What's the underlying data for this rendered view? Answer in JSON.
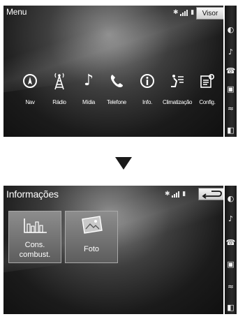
{
  "menu_screen": {
    "title": "Menu",
    "visor_button": "Visor",
    "items": [
      {
        "label": "Nav",
        "icon": "compass-icon"
      },
      {
        "label": "Rádio",
        "icon": "radio-tower-icon"
      },
      {
        "label": "Mídia",
        "icon": "music-note-icon"
      },
      {
        "label": "Telefone",
        "icon": "phone-icon"
      },
      {
        "label": "Info.",
        "icon": "info-icon"
      },
      {
        "label": "Climatização",
        "icon": "climate-icon"
      },
      {
        "label": "Config.",
        "icon": "settings-icon"
      }
    ]
  },
  "info_screen": {
    "title": "Informações",
    "tiles": [
      {
        "line1": "Cons.",
        "line2": "combust.",
        "icon": "bar-chart-icon"
      },
      {
        "label": "Foto",
        "icon": "photo-icon"
      }
    ]
  },
  "side_rail_icons": [
    "compass-icon",
    "music-note-icon",
    "phone-icon",
    "picture-icon",
    "climate-icon",
    "display-icon"
  ]
}
